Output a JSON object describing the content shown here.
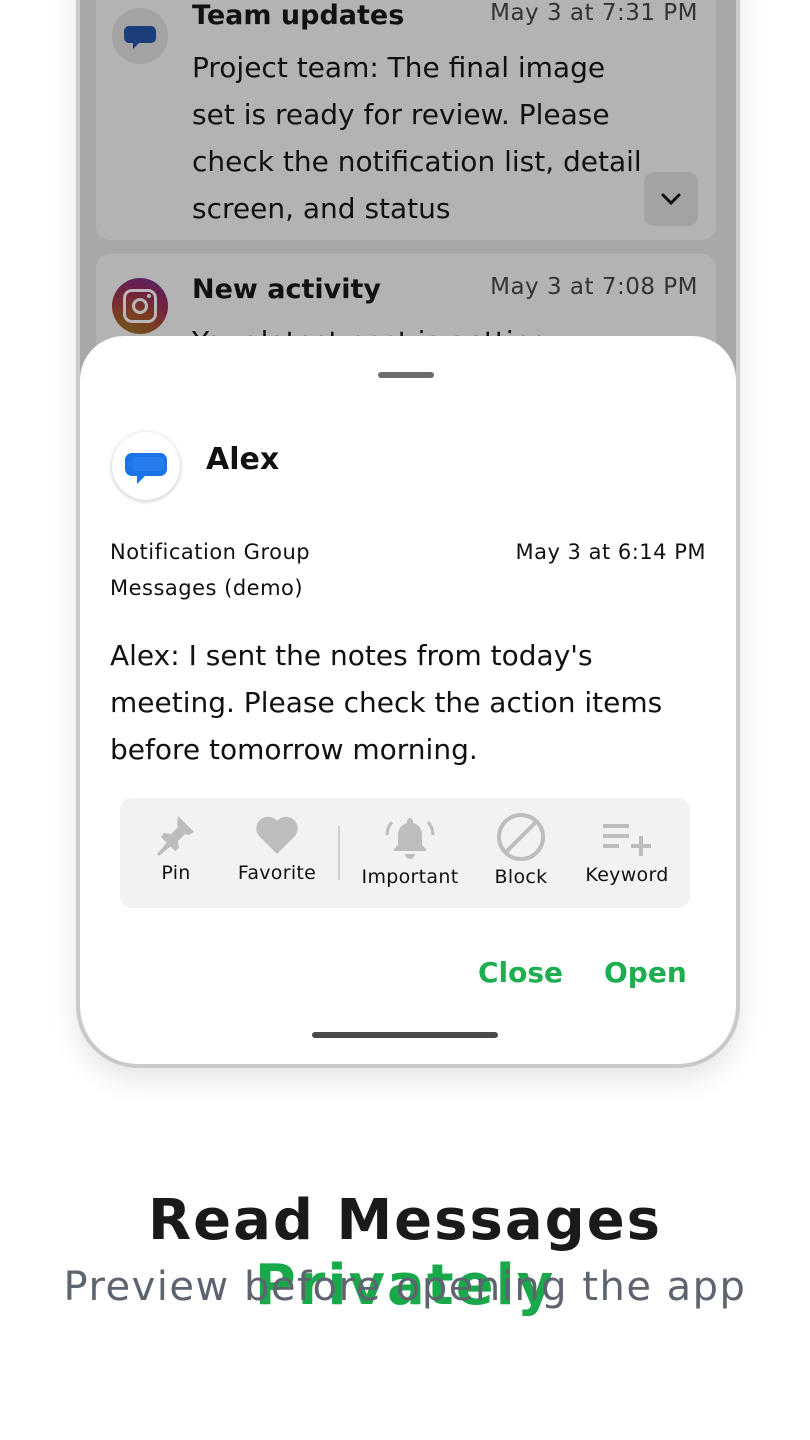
{
  "background_notifications": [
    {
      "title": "Team updates",
      "time": "May 3 at 7:31 PM",
      "body": "Project team: The final image set is ready for review. Please check the notification list, detail screen, and status",
      "icon": "messages-bubble-icon"
    },
    {
      "title": "New activity",
      "time": "May 3 at 7:08 PM",
      "body": "Your latest post is getting",
      "icon": "instagram-icon"
    }
  ],
  "detail": {
    "sender": "Alex",
    "group_line1": "Notification Group",
    "group_line2": "Messages (demo)",
    "time": "May 3 at 6:14 PM",
    "message": "Alex: I sent the notes from today's meeting. Please check the action items before tomorrow morning.",
    "actions": [
      {
        "label": "Pin",
        "icon": "pin-icon"
      },
      {
        "label": "Favorite",
        "icon": "heart-icon"
      },
      {
        "label": "Important",
        "icon": "bell-icon"
      },
      {
        "label": "Block",
        "icon": "block-icon"
      },
      {
        "label": "Keyword",
        "icon": "keyword-add-icon"
      }
    ],
    "close_label": "Close",
    "open_label": "Open"
  },
  "promo": {
    "headline_main": "Read Messages",
    "headline_accent": "Privately",
    "subline": "Preview before opening the app"
  },
  "colors": {
    "accent_green": "#1fae4f",
    "messages_blue": "#1a73e8"
  }
}
